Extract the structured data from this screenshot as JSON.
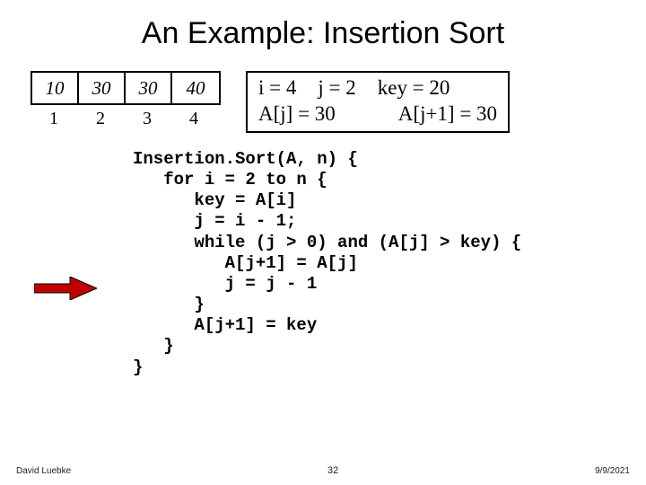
{
  "title": "An Example: Insertion Sort",
  "array": {
    "cells": [
      "10",
      "30",
      "30",
      "40"
    ],
    "indices": [
      "1",
      "2",
      "3",
      "4"
    ]
  },
  "state": {
    "i": "i = 4",
    "j": "j = 2",
    "key": "key = 20",
    "aj": "A[j] = 30",
    "aj1": "A[j+1] = 30"
  },
  "code": "Insertion.Sort(A, n) {\n   for i = 2 to n {\n      key = A[i]\n      j = i - 1;\n      while (j > 0) and (A[j] > key) {\n         A[j+1] = A[j]\n         j = j - 1\n      }\n      A[j+1] = key\n   }\n}",
  "footer": {
    "author": "David Luebke",
    "page": "32",
    "date": "9/9/2021"
  }
}
